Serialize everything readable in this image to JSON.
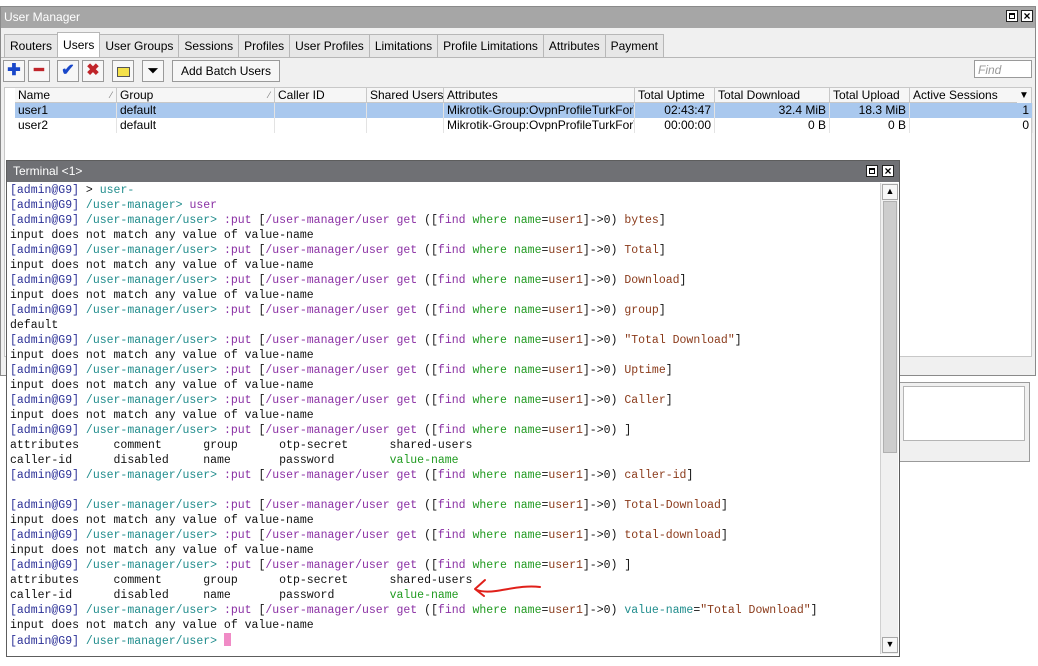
{
  "window": {
    "title": "User Manager"
  },
  "tabs": [
    "Routers",
    "Users",
    "User Groups",
    "Sessions",
    "Profiles",
    "User Profiles",
    "Limitations",
    "Profile Limitations",
    "Attributes",
    "Payment"
  ],
  "active_tab": "Users",
  "toolbar": {
    "add_batch_label": "Add Batch Users",
    "find_placeholder": "Find"
  },
  "table": {
    "columns": [
      "Name",
      "Group",
      "Caller ID",
      "Shared Users",
      "Attributes",
      "Total Uptime",
      "Total Download",
      "Total Upload",
      "Active Sessions"
    ],
    "rows": [
      {
        "name": "user1",
        "group": "default",
        "caller_id": "",
        "shared_users": "",
        "attributes": "Mikrotik-Group:OvpnProfileTurkForTest",
        "uptime": "02:43:47",
        "download": "32.4 MiB",
        "upload": "18.3 MiB",
        "active": "1"
      },
      {
        "name": "user2",
        "group": "default",
        "caller_id": "",
        "shared_users": "",
        "attributes": "Mikrotik-Group:OvpnProfileTurkForTest",
        "uptime": "00:00:00",
        "download": "0 B",
        "upload": "0 B",
        "active": "0"
      }
    ]
  },
  "terminal": {
    "title": "Terminal <1>",
    "lines": [
      [
        [
          "adm",
          "[admin@G9]"
        ],
        [
          "def",
          " > "
        ],
        [
          "path",
          "user-"
        ]
      ],
      [
        [
          "adm",
          "[admin@G9]"
        ],
        [
          "path",
          " /user-manager> "
        ],
        [
          "cmd",
          "user"
        ]
      ],
      [
        [
          "adm",
          "[admin@G9]"
        ],
        [
          "path",
          " /user-manager/user> "
        ],
        [
          "cmd",
          ":put "
        ],
        [
          "def",
          "["
        ],
        [
          "cmd",
          "/user-manager/user get "
        ],
        [
          "def",
          "(["
        ],
        [
          "cmd",
          "find "
        ],
        [
          "kw",
          "where "
        ],
        [
          "kw",
          "name"
        ],
        [
          "def",
          "="
        ],
        [
          "lit",
          "user1"
        ],
        [
          "def",
          "]->0) "
        ],
        [
          "lit",
          "bytes"
        ],
        [
          "def",
          "]"
        ]
      ],
      [
        [
          "def",
          "input does not match any value of value-name"
        ]
      ],
      [
        [
          "adm",
          "[admin@G9]"
        ],
        [
          "path",
          " /user-manager/user> "
        ],
        [
          "cmd",
          ":put "
        ],
        [
          "def",
          "["
        ],
        [
          "cmd",
          "/user-manager/user get "
        ],
        [
          "def",
          "(["
        ],
        [
          "cmd",
          "find "
        ],
        [
          "kw",
          "where "
        ],
        [
          "kw",
          "name"
        ],
        [
          "def",
          "="
        ],
        [
          "lit",
          "user1"
        ],
        [
          "def",
          "]->0) "
        ],
        [
          "lit",
          "Total"
        ],
        [
          "def",
          "]"
        ]
      ],
      [
        [
          "def",
          "input does not match any value of value-name"
        ]
      ],
      [
        [
          "adm",
          "[admin@G9]"
        ],
        [
          "path",
          " /user-manager/user> "
        ],
        [
          "cmd",
          ":put "
        ],
        [
          "def",
          "["
        ],
        [
          "cmd",
          "/user-manager/user get "
        ],
        [
          "def",
          "(["
        ],
        [
          "cmd",
          "find "
        ],
        [
          "kw",
          "where "
        ],
        [
          "kw",
          "name"
        ],
        [
          "def",
          "="
        ],
        [
          "lit",
          "user1"
        ],
        [
          "def",
          "]->0) "
        ],
        [
          "lit",
          "Download"
        ],
        [
          "def",
          "]"
        ]
      ],
      [
        [
          "def",
          "input does not match any value of value-name"
        ]
      ],
      [
        [
          "adm",
          "[admin@G9]"
        ],
        [
          "path",
          " /user-manager/user> "
        ],
        [
          "cmd",
          ":put "
        ],
        [
          "def",
          "["
        ],
        [
          "cmd",
          "/user-manager/user get "
        ],
        [
          "def",
          "(["
        ],
        [
          "cmd",
          "find "
        ],
        [
          "kw",
          "where "
        ],
        [
          "kw",
          "name"
        ],
        [
          "def",
          "="
        ],
        [
          "lit",
          "user1"
        ],
        [
          "def",
          "]->0) "
        ],
        [
          "lit",
          "group"
        ],
        [
          "def",
          "]"
        ]
      ],
      [
        [
          "def",
          "default"
        ]
      ],
      [
        [
          "adm",
          "[admin@G9]"
        ],
        [
          "path",
          " /user-manager/user> "
        ],
        [
          "cmd",
          ":put "
        ],
        [
          "def",
          "["
        ],
        [
          "cmd",
          "/user-manager/user get "
        ],
        [
          "def",
          "(["
        ],
        [
          "cmd",
          "find "
        ],
        [
          "kw",
          "where "
        ],
        [
          "kw",
          "name"
        ],
        [
          "def",
          "="
        ],
        [
          "lit",
          "user1"
        ],
        [
          "def",
          "]->0) "
        ],
        [
          "lit",
          "\"Total Download\""
        ],
        [
          "def",
          "]"
        ]
      ],
      [
        [
          "def",
          "input does not match any value of value-name"
        ]
      ],
      [
        [
          "adm",
          "[admin@G9]"
        ],
        [
          "path",
          " /user-manager/user> "
        ],
        [
          "cmd",
          ":put "
        ],
        [
          "def",
          "["
        ],
        [
          "cmd",
          "/user-manager/user get "
        ],
        [
          "def",
          "(["
        ],
        [
          "cmd",
          "find "
        ],
        [
          "kw",
          "where "
        ],
        [
          "kw",
          "name"
        ],
        [
          "def",
          "="
        ],
        [
          "lit",
          "user1"
        ],
        [
          "def",
          "]->0) "
        ],
        [
          "lit",
          "Uptime"
        ],
        [
          "def",
          "]"
        ]
      ],
      [
        [
          "def",
          "input does not match any value of value-name"
        ]
      ],
      [
        [
          "adm",
          "[admin@G9]"
        ],
        [
          "path",
          " /user-manager/user> "
        ],
        [
          "cmd",
          ":put "
        ],
        [
          "def",
          "["
        ],
        [
          "cmd",
          "/user-manager/user get "
        ],
        [
          "def",
          "(["
        ],
        [
          "cmd",
          "find "
        ],
        [
          "kw",
          "where "
        ],
        [
          "kw",
          "name"
        ],
        [
          "def",
          "="
        ],
        [
          "lit",
          "user1"
        ],
        [
          "def",
          "]->0) "
        ],
        [
          "lit",
          "Caller"
        ],
        [
          "def",
          "]"
        ]
      ],
      [
        [
          "def",
          "input does not match any value of value-name"
        ]
      ],
      [
        [
          "adm",
          "[admin@G9]"
        ],
        [
          "path",
          " /user-manager/user> "
        ],
        [
          "cmd",
          ":put "
        ],
        [
          "def",
          "["
        ],
        [
          "cmd",
          "/user-manager/user get "
        ],
        [
          "def",
          "(["
        ],
        [
          "cmd",
          "find "
        ],
        [
          "kw",
          "where "
        ],
        [
          "kw",
          "name"
        ],
        [
          "def",
          "="
        ],
        [
          "lit",
          "user1"
        ],
        [
          "def",
          "]->0) "
        ],
        [
          "def",
          "]"
        ]
      ],
      [
        [
          "def",
          "attributes     comment      group      otp-secret      shared-users"
        ]
      ],
      [
        [
          "def",
          "caller-id      disabled     name       password        "
        ],
        [
          "kw",
          "value-name"
        ]
      ],
      [
        [
          "adm",
          "[admin@G9]"
        ],
        [
          "path",
          " /user-manager/user> "
        ],
        [
          "cmd",
          ":put "
        ],
        [
          "def",
          "["
        ],
        [
          "cmd",
          "/user-manager/user get "
        ],
        [
          "def",
          "(["
        ],
        [
          "cmd",
          "find "
        ],
        [
          "kw",
          "where "
        ],
        [
          "kw",
          "name"
        ],
        [
          "def",
          "="
        ],
        [
          "lit",
          "user1"
        ],
        [
          "def",
          "]->0) "
        ],
        [
          "lit",
          "caller-id"
        ],
        [
          "def",
          "]"
        ]
      ],
      [
        [
          "def",
          ""
        ]
      ],
      [
        [
          "adm",
          "[admin@G9]"
        ],
        [
          "path",
          " /user-manager/user> "
        ],
        [
          "cmd",
          ":put "
        ],
        [
          "def",
          "["
        ],
        [
          "cmd",
          "/user-manager/user get "
        ],
        [
          "def",
          "(["
        ],
        [
          "cmd",
          "find "
        ],
        [
          "kw",
          "where "
        ],
        [
          "kw",
          "name"
        ],
        [
          "def",
          "="
        ],
        [
          "lit",
          "user1"
        ],
        [
          "def",
          "]->0) "
        ],
        [
          "lit",
          "Total-Download"
        ],
        [
          "def",
          "]"
        ]
      ],
      [
        [
          "def",
          "input does not match any value of value-name"
        ]
      ],
      [
        [
          "adm",
          "[admin@G9]"
        ],
        [
          "path",
          " /user-manager/user> "
        ],
        [
          "cmd",
          ":put "
        ],
        [
          "def",
          "["
        ],
        [
          "cmd",
          "/user-manager/user get "
        ],
        [
          "def",
          "(["
        ],
        [
          "cmd",
          "find "
        ],
        [
          "kw",
          "where "
        ],
        [
          "kw",
          "name"
        ],
        [
          "def",
          "="
        ],
        [
          "lit",
          "user1"
        ],
        [
          "def",
          "]->0) "
        ],
        [
          "lit",
          "total-download"
        ],
        [
          "def",
          "]"
        ]
      ],
      [
        [
          "def",
          "input does not match any value of value-name"
        ]
      ],
      [
        [
          "adm",
          "[admin@G9]"
        ],
        [
          "path",
          " /user-manager/user> "
        ],
        [
          "cmd",
          ":put "
        ],
        [
          "def",
          "["
        ],
        [
          "cmd",
          "/user-manager/user get "
        ],
        [
          "def",
          "(["
        ],
        [
          "cmd",
          "find "
        ],
        [
          "kw",
          "where "
        ],
        [
          "kw",
          "name"
        ],
        [
          "def",
          "="
        ],
        [
          "lit",
          "user1"
        ],
        [
          "def",
          "]->0) "
        ],
        [
          "def",
          "]"
        ]
      ],
      [
        [
          "def",
          "attributes     comment      group      otp-secret      shared-users"
        ]
      ],
      [
        [
          "def",
          "caller-id      disabled     name       password        "
        ],
        [
          "kw",
          "value-name"
        ]
      ],
      [
        [
          "adm",
          "[admin@G9]"
        ],
        [
          "path",
          " /user-manager/user> "
        ],
        [
          "cmd",
          ":put "
        ],
        [
          "def",
          "["
        ],
        [
          "cmd",
          "/user-manager/user get "
        ],
        [
          "def",
          "(["
        ],
        [
          "cmd",
          "find "
        ],
        [
          "kw",
          "where "
        ],
        [
          "kw",
          "name"
        ],
        [
          "def",
          "="
        ],
        [
          "lit",
          "user1"
        ],
        [
          "def",
          "]->0) "
        ],
        [
          "teal",
          "value-name"
        ],
        [
          "def",
          "="
        ],
        [
          "lit",
          "\"Total Download\""
        ],
        [
          "def",
          "]"
        ]
      ],
      [
        [
          "def",
          "input does not match any value of value-name"
        ]
      ],
      [
        [
          "adm",
          "[admin@G9]"
        ],
        [
          "path",
          " /user-manager/user> "
        ]
      ]
    ]
  },
  "colors": {
    "selection": "#a9c8ee",
    "annotation": "#e0201a",
    "terminal_title": "#6f7074"
  }
}
